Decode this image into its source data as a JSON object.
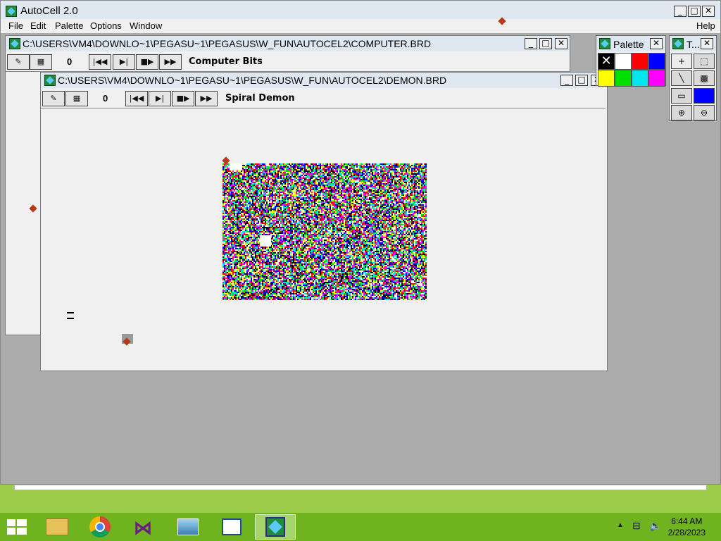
{
  "app": {
    "title": "AutoCell 2.0",
    "menus": [
      "File",
      "Edit",
      "Palette",
      "Options",
      "Window"
    ],
    "help_menu": "Help"
  },
  "win_computer": {
    "title": "C:\\USERS\\VM4\\DOWNLO~1\\PEGASU~1\\PEGASUS\\W_FUN\\AUTOCEL2\\COMPUTER.BRD",
    "generation": "0",
    "name": "Computer Bits"
  },
  "win_demon": {
    "title": "C:\\USERS\\VM4\\DOWNLO~1\\PEGASU~1\\PEGASUS\\W_FUN\\AUTOCEL2\\DEMON.BRD",
    "generation": "0",
    "name": "Spiral Demon"
  },
  "palette": {
    "title": "Palette",
    "colors": [
      "#000000",
      "#ffffff",
      "#ff0000",
      "#0000ff",
      "#ffff00",
      "#00e000",
      "#00e5ee",
      "#ff00ff"
    ]
  },
  "tools": {
    "title": "T..."
  },
  "taskbar": {
    "time": "6:44 AM",
    "date": "2/28/2023"
  },
  "board_colors": [
    "#000000",
    "#ffffff",
    "#ff0000",
    "#0000ff",
    "#ffff00",
    "#00e000",
    "#00e5ee",
    "#ff00ff"
  ]
}
